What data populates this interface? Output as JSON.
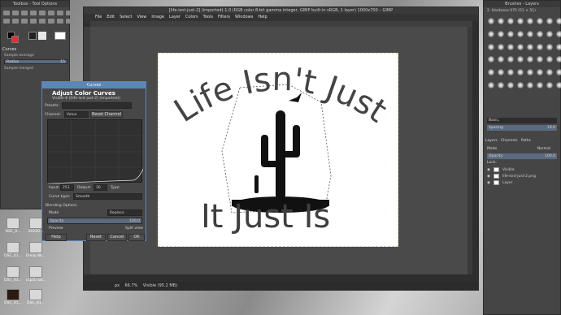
{
  "toolbox": {
    "title": "Toolbox - Tool Options",
    "options_title": "Curves",
    "sample_average": "Sample average",
    "radius_label": "Radius",
    "radius_value": "15",
    "sample_merged": "Sample merged"
  },
  "image_window": {
    "title": "[life-isnt-just-2] (imported)-1.0 (RGB color 8-bit gamma integer, GIMP built-in sRGB, 1 layer) 1000x700 – GIMP",
    "menu": [
      "File",
      "Edit",
      "Select",
      "View",
      "Image",
      "Layer",
      "Colors",
      "Tools",
      "Filters",
      "Windows",
      "Help"
    ],
    "status_unit": "px",
    "status_zoom": "66.7%",
    "status_text": "Visible (95.2 MB)"
  },
  "artwork": {
    "top_text": "Life Isn't Just",
    "bottom_text": "It Just Is"
  },
  "right_panel": {
    "title": "Brushes - Layers",
    "brush_name": "2. Hardness 075 (51 × 51)",
    "preset": "Basic,",
    "spacing_label": "Spacing",
    "spacing_value": "10.0",
    "tabs": [
      "Layers",
      "Channels",
      "Paths"
    ],
    "mode_label": "Mode",
    "mode_value": "Normal",
    "opacity_label": "Opacity",
    "opacity_value": "100.0",
    "lock_label": "Lock:",
    "layers": [
      "Visible",
      "life-isnt-just-2.png",
      "Layer"
    ]
  },
  "curves_dialog": {
    "window_title": "Curves",
    "heading": "Adjust Color Curves",
    "subtitle": "Visible-6 ([life-isnt-just-2] (imported))",
    "presets_label": "Presets:",
    "channel_label": "Channel:",
    "channel_value": "Value",
    "reset_channel": "Reset Channel",
    "input_label": "Input:",
    "input_value": "251",
    "output_label": "Output:",
    "output_value": "30",
    "type_label": "Type:",
    "curve_type_label": "Curve type:",
    "curve_type_value": "Smooth",
    "blending_label": "Blending Options",
    "mode_label": "Mode",
    "mode_value": "Replace",
    "opacity_label": "Opacity",
    "opacity_value": "100.0",
    "preview_label": "Preview",
    "split_view_label": "Split view",
    "help": "Help",
    "reset": "Reset",
    "cancel": "Cancel",
    "ok": "OK"
  },
  "desktop_icons": [
    {
      "label": "DSC_0..."
    },
    {
      "label": "20220..."
    },
    {
      "label": "DSC_01..."
    },
    {
      "label": "Emily Wi..."
    },
    {
      "label": "DSC_01..."
    },
    {
      "label": "ccpl2.naf..."
    },
    {
      "label": "DSC_01..."
    },
    {
      "label": "DSC_01..."
    }
  ]
}
